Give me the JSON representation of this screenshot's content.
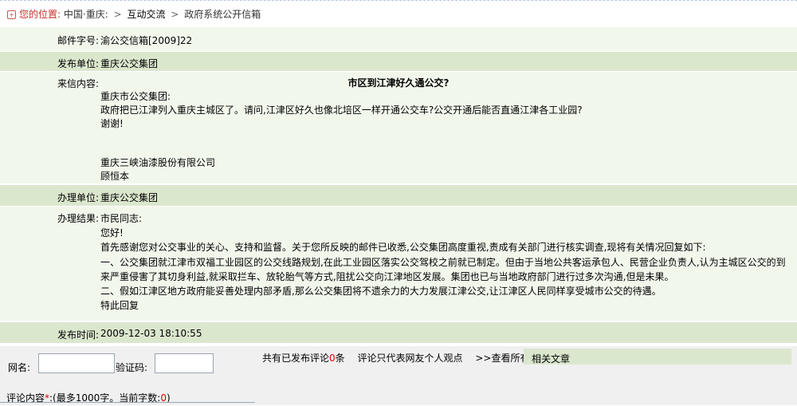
{
  "breadcrumb": {
    "icon": "location-icon",
    "you_are_here": "您的位置:",
    "home": "中国·重庆:",
    "sep1": ">",
    "section": "互动交流",
    "sep2": ">",
    "page": "政府系统公开信箱"
  },
  "fields": {
    "mail_no_label": "邮件字号:",
    "mail_no_value": "渝公交信箱[2009]22",
    "publisher_label": "发布单位:",
    "publisher_value": "重庆公交集团",
    "letter_label": "来信内容:",
    "letter_title": "市区到江津好久通公交?",
    "letter_lines": [
      "重庆市公交集团:",
      "政府把已江津列入重庆主城区了。请问,江津区好久也像北培区一样开通公交车?公交开通后能否直通江津各工业园?",
      "谢谢!",
      "",
      "重庆三峡油漆股份有限公司",
      "顾恒本"
    ],
    "handler_label": "办理单位:",
    "handler_value": "重庆公交集团",
    "result_label": "办理结果:",
    "result_lines": [
      "市民同志:",
      "您好!",
      "首先感谢您对公交事业的关心、支持和监督。关于您所反映的邮件已收悉,公交集团高度重视,责成有关部门进行核实调查,现将有关情况回复如下:",
      "一、公交集团就江津市双福工业园区的公交线路规划,在此工业园区落实公交驾校之前就已制定。但由于当地公共客运承包人、民营企业负责人,认为主城区公交的到",
      "来严重侵害了其切身利益,就采取拦车、放轮胎气等方式,阻扰公交向江津地区发展。集团也已与当地政府部门进行过多次沟通,但是未果。",
      "二、假如江津区地方政府能妥善处理内部矛盾,那么公交集团将不遗余力的大力发展江津公交,让江津区人民同样享受城市公交的待遇。",
      "特此回复"
    ],
    "time_label": "发布时间:",
    "time_value": "2009-12-03 18:10:55"
  },
  "comment": {
    "name_label": "网名:",
    "name_value": "",
    "captcha_label": "验证码:",
    "captcha_value": "",
    "count_prefix": "共有已发布评论",
    "count_value": "0",
    "count_suffix": "条",
    "disclaimer": "评论只代表网友个人观点",
    "view_all": ">>查看所有",
    "related_label": "相关文章",
    "content_label": "评论内容",
    "required_mark": "*",
    "content_hint_prefix": ":(最多1000字。当前字数:",
    "content_count": "0",
    "content_hint_suffix": ")"
  }
}
